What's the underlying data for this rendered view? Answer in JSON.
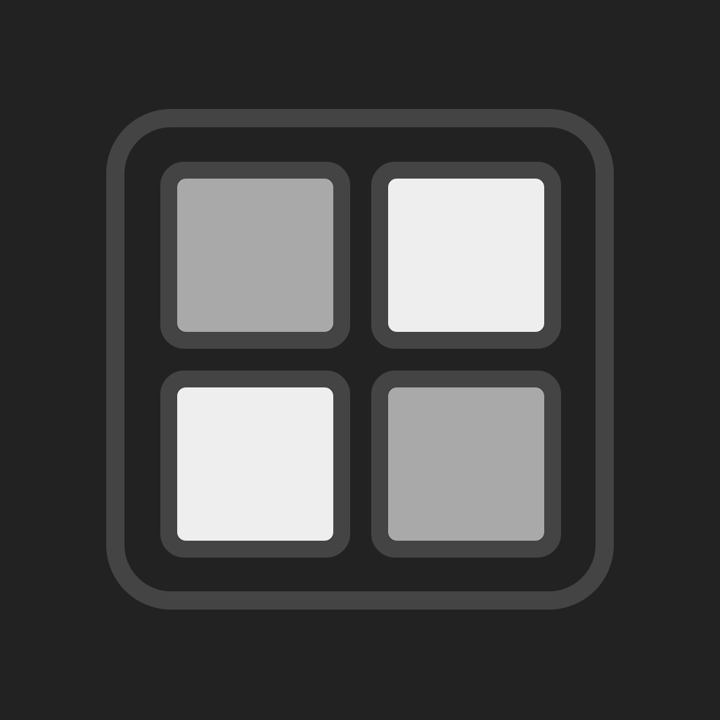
{
  "icon": {
    "name": "grid-app-icon",
    "colors": {
      "background": "#222222",
      "frame": "#444444",
      "tile_border": "#444444",
      "tile_dim": "#a9a9a9",
      "tile_bright": "#eeeeee"
    },
    "tiles": [
      {
        "name": "tile-top-left",
        "fill": "#a9a9a9"
      },
      {
        "name": "tile-top-right",
        "fill": "#eeeeee"
      },
      {
        "name": "tile-bottom-left",
        "fill": "#eeeeee"
      },
      {
        "name": "tile-bottom-right",
        "fill": "#a9a9a9"
      }
    ]
  }
}
